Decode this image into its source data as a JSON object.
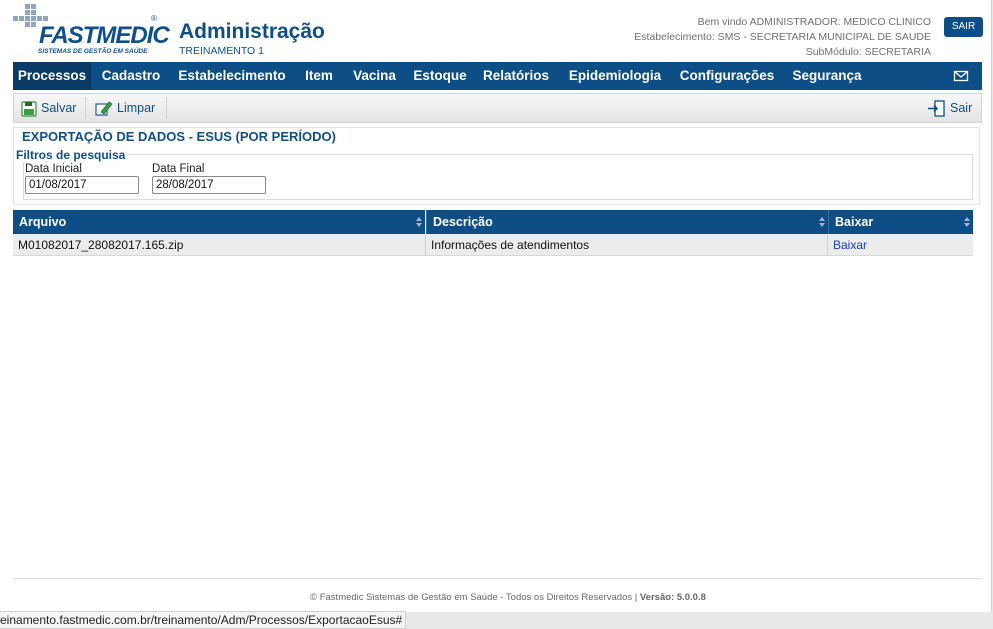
{
  "header": {
    "brand": "FASTMEDIC",
    "tagline": "SISTEMAS DE GESTÃO EM SAÚDE",
    "title": "Administração",
    "subtitle": "TREINAMENTO 1",
    "welcome": "Bem vindo ADMINISTRADOR: MEDICO CLINICO",
    "establishment": "Estabelecimento: SMS - SECRETARIA MUNICIPAL DE SAUDE",
    "submodule": "SubMódulo: SECRETARIA",
    "logout_label": "SAIR"
  },
  "menu": {
    "items": [
      "Processos",
      "Cadastro",
      "Estabelecimento",
      "Item",
      "Vacina",
      "Estoque",
      "Relatórios",
      "Epidemiologia",
      "Configurações",
      "Segurança"
    ],
    "active": "Processos",
    "mail_icon": "envelope-icon"
  },
  "toolbar": {
    "save_label": "Salvar",
    "clear_label": "Limpar",
    "exit_label": "Sair"
  },
  "panel": {
    "title": "EXPORTAÇÃO DE DADOS - ESUS (POR PERÍODO)",
    "filters_legend": "Filtros de pesquisa",
    "start_label": "Data Inicial",
    "start_value": "01/08/2017",
    "end_label": "Data Final",
    "end_value": "28/08/2017"
  },
  "grid": {
    "columns": [
      "Arquivo",
      "Descrição",
      "Baixar"
    ],
    "rows": [
      {
        "arquivo": "M01082017_28082017.165.zip",
        "descricao": "Informações de atendimentos",
        "baixar": "Baixar"
      }
    ]
  },
  "footer": {
    "text": "© Fastmedic Sistemas de Gestão em Saúde - Todos os Direitos Reservados | ",
    "version": "Versão: 5.0.0.8"
  },
  "status_url": "einamento.fastmedic.com.br/treinamento/Adm/Processos/ExportacaoEsus#",
  "colors": {
    "primary": "#0e4e86",
    "active_menu": "#0a3a66",
    "link": "#1a3fb3"
  }
}
